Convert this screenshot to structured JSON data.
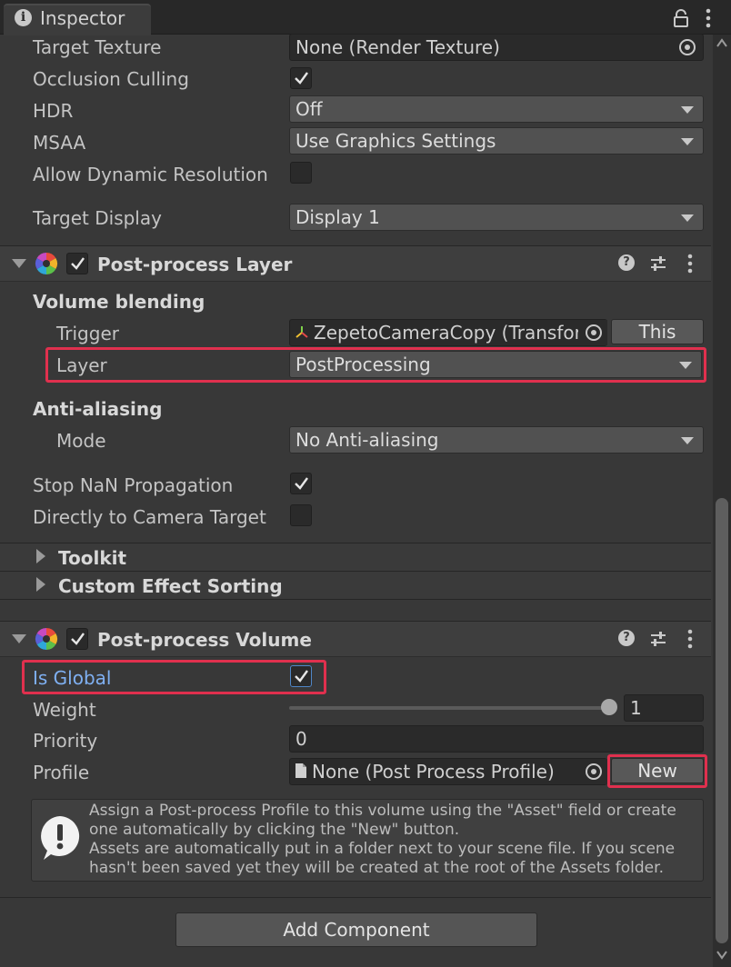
{
  "tab": {
    "title": "Inspector"
  },
  "camera": {
    "target_texture": {
      "label": "Target Texture",
      "value": "None (Render Texture)"
    },
    "occlusion_culling": {
      "label": "Occlusion Culling",
      "checked": true
    },
    "hdr": {
      "label": "HDR",
      "value": "Off"
    },
    "msaa": {
      "label": "MSAA",
      "value": "Use Graphics Settings"
    },
    "allow_dynamic_resolution": {
      "label": "Allow Dynamic Resolution",
      "checked": false
    },
    "target_display": {
      "label": "Target Display",
      "value": "Display 1"
    }
  },
  "post_process_layer": {
    "title": "Post-process Layer",
    "enabled": true,
    "volume_blending": "Volume blending",
    "trigger": {
      "label": "Trigger",
      "value": "ZepetoCameraCopy (Transfor",
      "button": "This"
    },
    "layer": {
      "label": "Layer",
      "value": "PostProcessing"
    },
    "anti_aliasing": "Anti-aliasing",
    "mode": {
      "label": "Mode",
      "value": "No Anti-aliasing"
    },
    "stop_nan": {
      "label": "Stop NaN Propagation",
      "checked": true
    },
    "directly_to_camera": {
      "label": "Directly to Camera Target",
      "checked": false
    },
    "toolkit": "Toolkit",
    "custom_effect_sorting": "Custom Effect Sorting"
  },
  "post_process_volume": {
    "title": "Post-process Volume",
    "enabled": true,
    "is_global": {
      "label": "Is Global",
      "checked": true
    },
    "weight": {
      "label": "Weight",
      "value": "1",
      "slider_fraction": 1.0
    },
    "priority": {
      "label": "Priority",
      "value": "0"
    },
    "profile": {
      "label": "Profile",
      "value": "None (Post Process Profile)",
      "button": "New"
    },
    "help_lines": [
      "Assign a Post-process Profile to this volume using the \"Asset\" field or create",
      "one automatically by clicking the \"New\" button.",
      "Assets are automatically put in a folder next to your scene file. If you scene",
      "hasn't been saved yet they will be created at the root of the Assets folder."
    ]
  },
  "add_component": "Add Component",
  "colors": {
    "highlight": "#e0304e",
    "link_blue": "#7fb0f2",
    "background": "#383838"
  }
}
